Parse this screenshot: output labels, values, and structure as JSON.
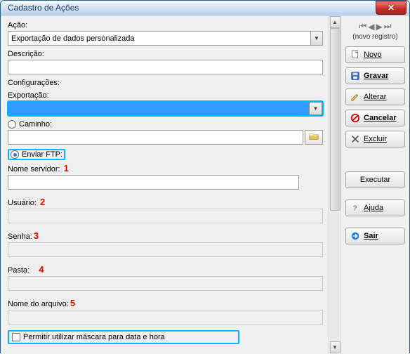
{
  "window": {
    "title": "Cadastro de Ações"
  },
  "fields": {
    "acao_label": "Ação:",
    "acao_value": "Exportação de dados personalizada",
    "descricao_label": "Descrição:",
    "descricao_value": "",
    "config_label": "Configurações:",
    "export_label": "Exportação:",
    "export_value": "",
    "caminho_label": "Caminho:",
    "caminho_value": "",
    "enviar_ftp_label": "Enviar FTP:",
    "nome_servidor_label": "Nome servidor:",
    "usuario_label": "Usuário:",
    "senha_label": "Senha:",
    "pasta_label": "Pasta:",
    "nome_arquivo_label": "Nome do arquivo:",
    "mascara_label": "Permitir utilizar máscara para data e hora"
  },
  "annotations": {
    "n1": "1",
    "n2": "2",
    "n3": "3",
    "n4": "4",
    "n5": "5"
  },
  "nav": {
    "caption": "(novo registro)"
  },
  "buttons": {
    "novo": "Novo",
    "gravar": "Gravar",
    "alterar": "Alterar",
    "cancelar": "Cancelar",
    "excluir": "Excluir",
    "executar": "Executar",
    "ajuda": "Ajuda",
    "sair": "Sair"
  }
}
